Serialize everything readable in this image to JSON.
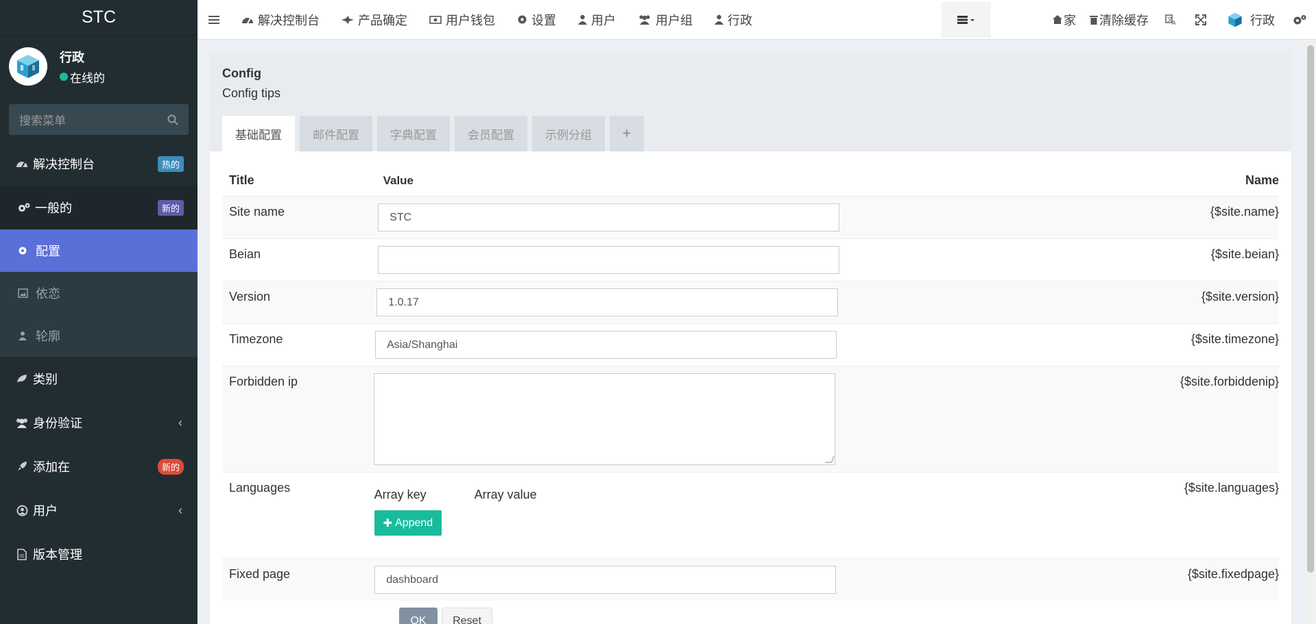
{
  "app": {
    "logo": "STC"
  },
  "user": {
    "name": "行政",
    "status": "在线的"
  },
  "search": {
    "placeholder": "搜索菜单"
  },
  "sidebar": {
    "items": [
      {
        "label": "解决控制台",
        "badge": "热的",
        "badge_color": "#3c8dbc"
      },
      {
        "label": "一般的",
        "badge": "新的",
        "badge_color": "#605ca8"
      },
      {
        "label": "类别"
      },
      {
        "label": "身份验证"
      },
      {
        "label": "添加在",
        "badge": "新的",
        "badge_color": "#dd4b39"
      },
      {
        "label": "用户"
      },
      {
        "label": "版本管理"
      }
    ],
    "sub": [
      {
        "label": "配置"
      },
      {
        "label": "依恋"
      },
      {
        "label": "轮廓"
      }
    ]
  },
  "topbar": {
    "nav": [
      "解决控制台",
      "产品确定",
      "用户钱包",
      "设置",
      "用户",
      "用户组",
      "行政"
    ],
    "home": "家",
    "clear_cache": "清除缓存",
    "admin": "行政"
  },
  "page": {
    "title": "Config",
    "tips": "Config tips",
    "tabs": [
      "基础配置",
      "邮件配置",
      "字典配置",
      "会员配置",
      "示例分组",
      "+"
    ]
  },
  "table": {
    "head": {
      "title": "Title",
      "value": "Value",
      "name": "Name"
    },
    "rows": [
      {
        "title": "Site name",
        "value": "STC",
        "name": "{$site.name}"
      },
      {
        "title": "Beian",
        "value": "",
        "name": "{$site.beian}"
      },
      {
        "title": "Version",
        "value": "1.0.17",
        "name": "{$site.version}"
      },
      {
        "title": "Timezone",
        "value": "Asia/Shanghai",
        "name": "{$site.timezone}"
      },
      {
        "title": "Forbidden ip",
        "value": "",
        "name": "{$site.forbiddenip}"
      },
      {
        "title": "Languages",
        "array_key": "Array key",
        "array_value": "Array value",
        "append": "Append",
        "name": "{$site.languages}"
      },
      {
        "title": "Fixed page",
        "value": "dashboard",
        "name": "{$site.fixedpage}"
      }
    ]
  },
  "actions": {
    "ok": "OK",
    "reset": "Reset"
  }
}
